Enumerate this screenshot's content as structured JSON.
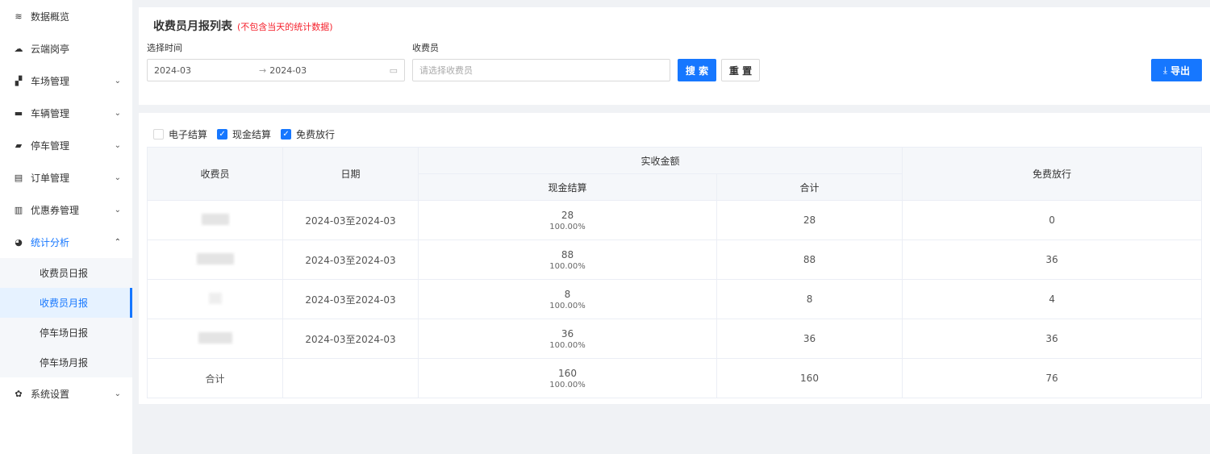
{
  "sidebar": {
    "items": [
      {
        "label": "数据概览",
        "icon": "layers-icon",
        "has_arrow": false
      },
      {
        "label": "云端岗亭",
        "icon": "cloud-icon",
        "has_arrow": false
      },
      {
        "label": "车场管理",
        "icon": "binoculars-icon",
        "has_arrow": true
      },
      {
        "label": "车辆管理",
        "icon": "car-icon",
        "has_arrow": true
      },
      {
        "label": "停车管理",
        "icon": "parking-car-icon",
        "has_arrow": true
      },
      {
        "label": "订单管理",
        "icon": "clipboard-icon",
        "has_arrow": true
      },
      {
        "label": "优惠券管理",
        "icon": "ticket-icon",
        "has_arrow": true
      },
      {
        "label": "统计分析",
        "icon": "pie-chart-icon",
        "has_arrow": true,
        "expanded": true
      },
      {
        "label": "系统设置",
        "icon": "gear-icon",
        "has_arrow": true
      }
    ],
    "submenu": [
      {
        "label": "收费员日报"
      },
      {
        "label": "收费员月报",
        "active": true
      },
      {
        "label": "停车场日报"
      },
      {
        "label": "停车场月报"
      }
    ]
  },
  "header": {
    "title": "收费员月报列表",
    "note": "(不包含当天的统计数据)"
  },
  "filters": {
    "time_label": "选择时间",
    "start": "2024-03",
    "end": "2024-03",
    "collector_label": "收费员",
    "collector_placeholder": "请选择收费员",
    "collector_value": "",
    "search": "搜 索",
    "reset": "重 置",
    "export": "导出"
  },
  "checkboxes": [
    {
      "label": "电子结算",
      "checked": false
    },
    {
      "label": "现金结算",
      "checked": true
    },
    {
      "label": "免费放行",
      "checked": true
    }
  ],
  "table": {
    "headers": {
      "collector": "收费员",
      "date": "日期",
      "received": "实收金额",
      "cash": "现金结算",
      "total": "合计",
      "free": "免费放行"
    },
    "rows": [
      {
        "collector": "",
        "date": "2024-03至2024-03",
        "cash": "28",
        "cash_pct": "100.00%",
        "total": "28",
        "free": "0"
      },
      {
        "collector": "",
        "date": "2024-03至2024-03",
        "cash": "88",
        "cash_pct": "100.00%",
        "total": "88",
        "free": "36"
      },
      {
        "collector": "",
        "date": "2024-03至2024-03",
        "cash": "8",
        "cash_pct": "100.00%",
        "total": "8",
        "free": "4"
      },
      {
        "collector": "",
        "date": "2024-03至2024-03",
        "cash": "36",
        "cash_pct": "100.00%",
        "total": "36",
        "free": "36"
      }
    ],
    "summary": {
      "label": "合计",
      "date": "",
      "cash": "160",
      "cash_pct": "100.00%",
      "total": "160",
      "free": "76"
    }
  },
  "colors": {
    "accent": "#1677ff",
    "note": "#f5222d",
    "submenu_active_bg": "#e6f2ff"
  }
}
